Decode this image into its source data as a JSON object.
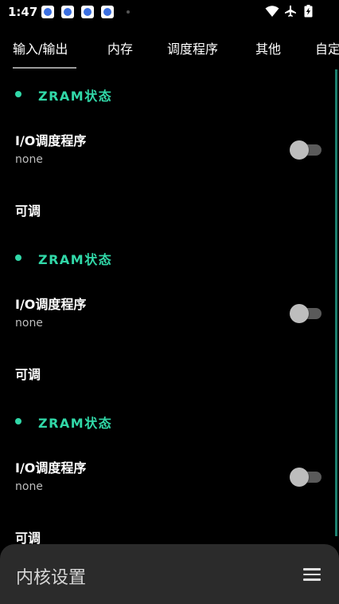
{
  "status_bar": {
    "time": "1:47",
    "notification_icons": [
      "paw-icon",
      "paw-icon",
      "paw-icon",
      "paw-icon"
    ],
    "system_icons": [
      "wifi-icon",
      "airplane-icon",
      "battery-icon"
    ]
  },
  "tabs": [
    {
      "label": "输入/输出",
      "active": true
    },
    {
      "label": "内存"
    },
    {
      "label": "调度程序"
    },
    {
      "label": "其他"
    },
    {
      "label": "自定"
    }
  ],
  "sections": [
    {
      "title": "ZRAM状态",
      "item_title": "I/O调度程序",
      "item_value": "none",
      "switch_on": false,
      "tunable_label": "可调"
    },
    {
      "title": "ZRAM状态",
      "item_title": "I/O调度程序",
      "item_value": "none",
      "switch_on": false,
      "tunable_label": "可调"
    },
    {
      "title": "ZRAM状态",
      "item_title": "I/O调度程序",
      "item_value": "none",
      "switch_on": false,
      "tunable_label": "可调"
    }
  ],
  "bottom_bar": {
    "title": "内核设置",
    "menu_icon": "menu-icon"
  },
  "colors": {
    "accent": "#31d8a8",
    "background": "#000000",
    "bottom_bar": "#2b2b2b"
  }
}
